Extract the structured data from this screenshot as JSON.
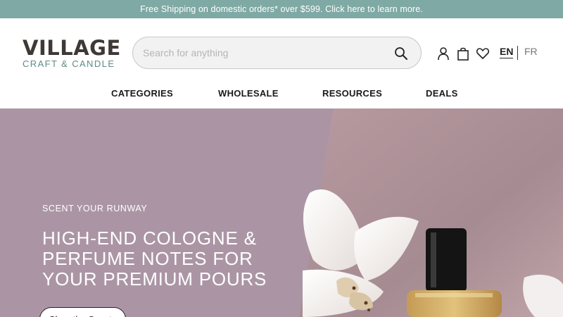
{
  "promo": {
    "text": "Free Shipping on domestic orders* over $599. Click here to learn more."
  },
  "brand": {
    "name": "VILLAGE",
    "tagline": "CRAFT & CANDLE"
  },
  "search": {
    "placeholder": "Search for anything",
    "value": "",
    "icon": "search-icon"
  },
  "header_icons": [
    {
      "name": "account",
      "icon": "user-icon"
    },
    {
      "name": "cart",
      "icon": "shopping-bag-icon"
    },
    {
      "name": "wishlist",
      "icon": "heart-icon"
    }
  ],
  "languages": {
    "active": "EN",
    "alternate": "FR"
  },
  "nav": [
    {
      "label": "CATEGORIES"
    },
    {
      "label": "WHOLESALE"
    },
    {
      "label": "RESOURCES"
    },
    {
      "label": "DEALS"
    }
  ],
  "hero": {
    "eyebrow": "SCENT YOUR RUNWAY",
    "title": "HIGH-END COLOGNE & PERFUME NOTES FOR YOUR PREMIUM POURS",
    "cta": "Shop the Scents"
  },
  "colors": {
    "promo_bg": "#7fa9a4",
    "brand_dark": "#3f3936",
    "brand_accent": "#5f8c86",
    "hero_bg": "#ab95a5"
  }
}
